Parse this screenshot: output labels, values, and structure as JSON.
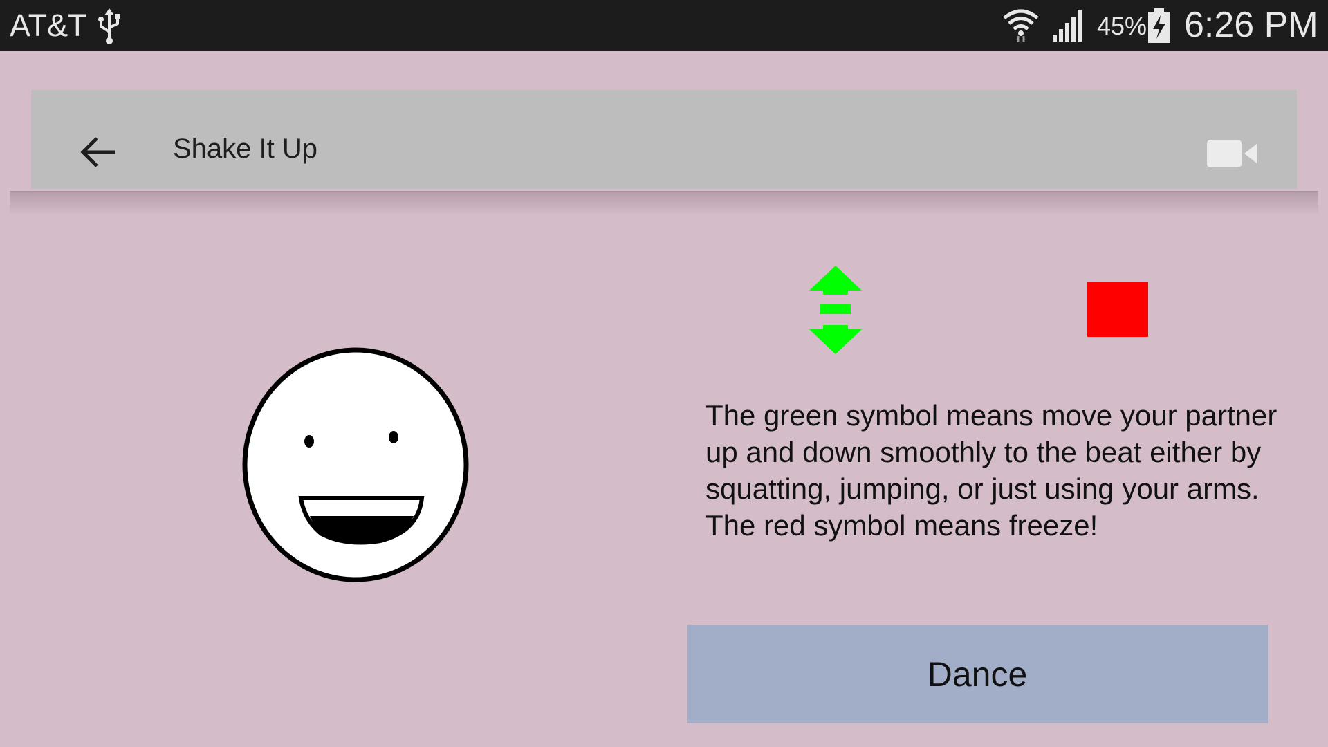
{
  "status_bar": {
    "carrier": "AT&T",
    "battery_percent": "45%",
    "time": "6:26 PM",
    "icons": [
      "usb-icon",
      "wifi-icon",
      "signal-icon",
      "battery-charging-icon"
    ]
  },
  "app_bar": {
    "back_icon": "arrow-left-icon",
    "title": "Shake It Up",
    "video_icon": "video-camera-icon"
  },
  "main": {
    "face_image": "smiley-face",
    "green_symbol": "up-down-arrow",
    "red_symbol": "stop-square",
    "description": "The green symbol means move your partner up and down smoothly to the beat either by squatting, jumping, or just using your arms. The red symbol means freeze!",
    "dance_label": "Dance"
  },
  "colors": {
    "background": "#d4bcc9",
    "status_bar": "#1c1c1c",
    "app_bar": "#bdbdbd",
    "green_symbol": "#00ff00",
    "red_symbol": "#ff0000",
    "dance_button": "#a2adc8"
  }
}
